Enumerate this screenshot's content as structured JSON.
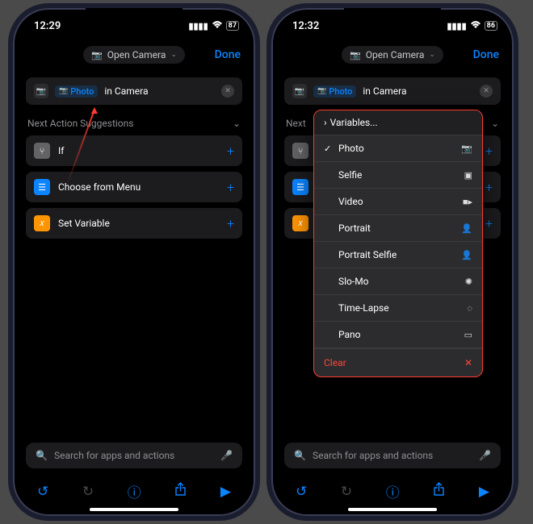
{
  "left": {
    "status": {
      "time": "12:29",
      "battery": "87"
    },
    "nav": {
      "title": "Open Camera",
      "done": "Done"
    },
    "action": {
      "mode": "Photo",
      "suffix": "in Camera"
    },
    "section_header": "Next Action Suggestions",
    "suggestions": [
      {
        "label": "If"
      },
      {
        "label": "Choose from Menu"
      },
      {
        "label": "Set Variable"
      }
    ],
    "search_placeholder": "Search for apps and actions"
  },
  "right": {
    "status": {
      "time": "12:32",
      "battery": "86"
    },
    "nav": {
      "title": "Open Camera",
      "done": "Done"
    },
    "action": {
      "mode": "Photo",
      "suffix": "in Camera"
    },
    "section_header": "Next",
    "dropdown": {
      "variables": "Variables...",
      "items": [
        {
          "label": "Photo",
          "icon": "camera",
          "checked": true
        },
        {
          "label": "Selfie",
          "icon": "person-square",
          "checked": false
        },
        {
          "label": "Video",
          "icon": "video",
          "checked": false
        },
        {
          "label": "Portrait",
          "icon": "person",
          "checked": false
        },
        {
          "label": "Portrait Selfie",
          "icon": "person",
          "checked": false
        },
        {
          "label": "Slo-Mo",
          "icon": "spinner",
          "checked": false
        },
        {
          "label": "Time-Lapse",
          "icon": "circle-dashed",
          "checked": false
        },
        {
          "label": "Pano",
          "icon": "panorama",
          "checked": false
        }
      ],
      "clear": "Clear"
    },
    "search_placeholder": "Search for apps and actions"
  }
}
